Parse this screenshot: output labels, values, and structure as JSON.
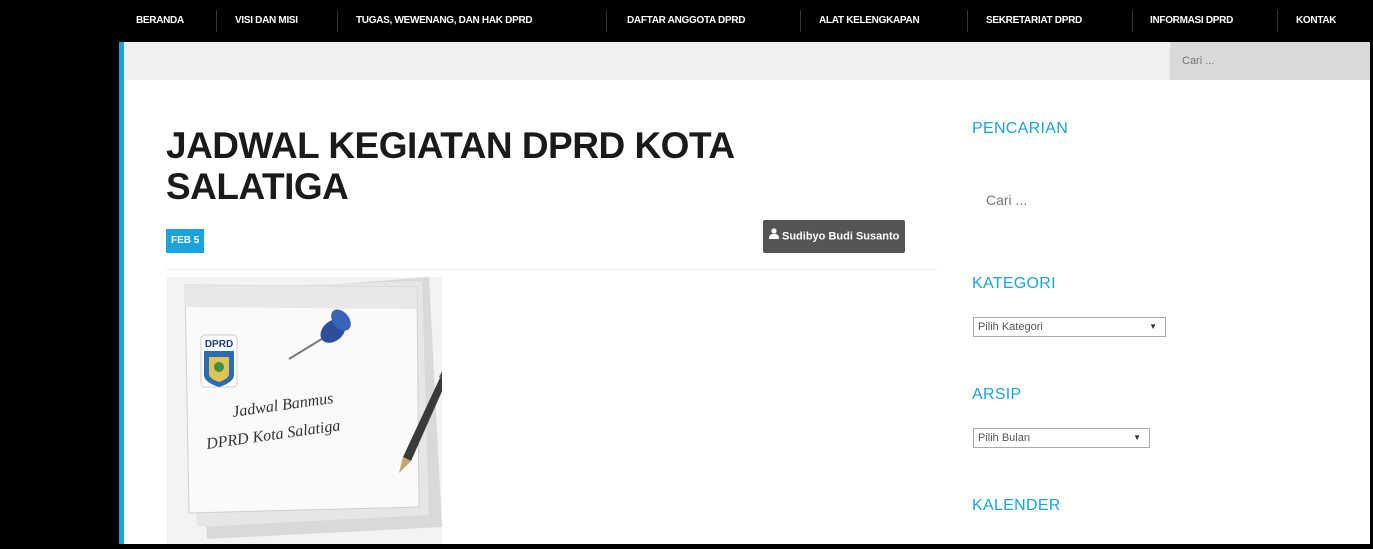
{
  "nav": {
    "items": [
      {
        "label": "BERANDA"
      },
      {
        "label": "VISI DAN MISI"
      },
      {
        "label": "TUGAS, WEWENANG, DAN HAK DPRD"
      },
      {
        "label": "DAFTAR ANGGOTA DPRD"
      },
      {
        "label": "ALAT KELENGKAPAN"
      },
      {
        "label": "SEKRETARIAT DPRD"
      },
      {
        "label": "INFORMASI DPRD"
      },
      {
        "label": "KONTAK"
      }
    ]
  },
  "search": {
    "placeholder": "Cari ..."
  },
  "post": {
    "title": "JADWAL KEGIATAN DPRD KOTA SALATIGA",
    "date": "FEB 5",
    "author": "Sudibyo Budi Susanto",
    "image": {
      "logo_text": "DPRD",
      "line1": "Jadwal Banmus",
      "line2": "DPRD Kota Salatiga"
    }
  },
  "sidebar": {
    "search_title": "PENCARIAN",
    "search_placeholder": "Cari ...",
    "category_title": "KATEGORI",
    "category_select": "Pilih Kategori",
    "archive_title": "ARSIP",
    "archive_select": "Pilih Bulan",
    "calendar_title": "KALENDER"
  },
  "colors": {
    "accent": "#1ba3dd",
    "nav_bg": "#000000",
    "author_bg": "#555555"
  },
  "icons": {
    "author": "user-icon",
    "dropdown": "chevron-down-icon"
  }
}
